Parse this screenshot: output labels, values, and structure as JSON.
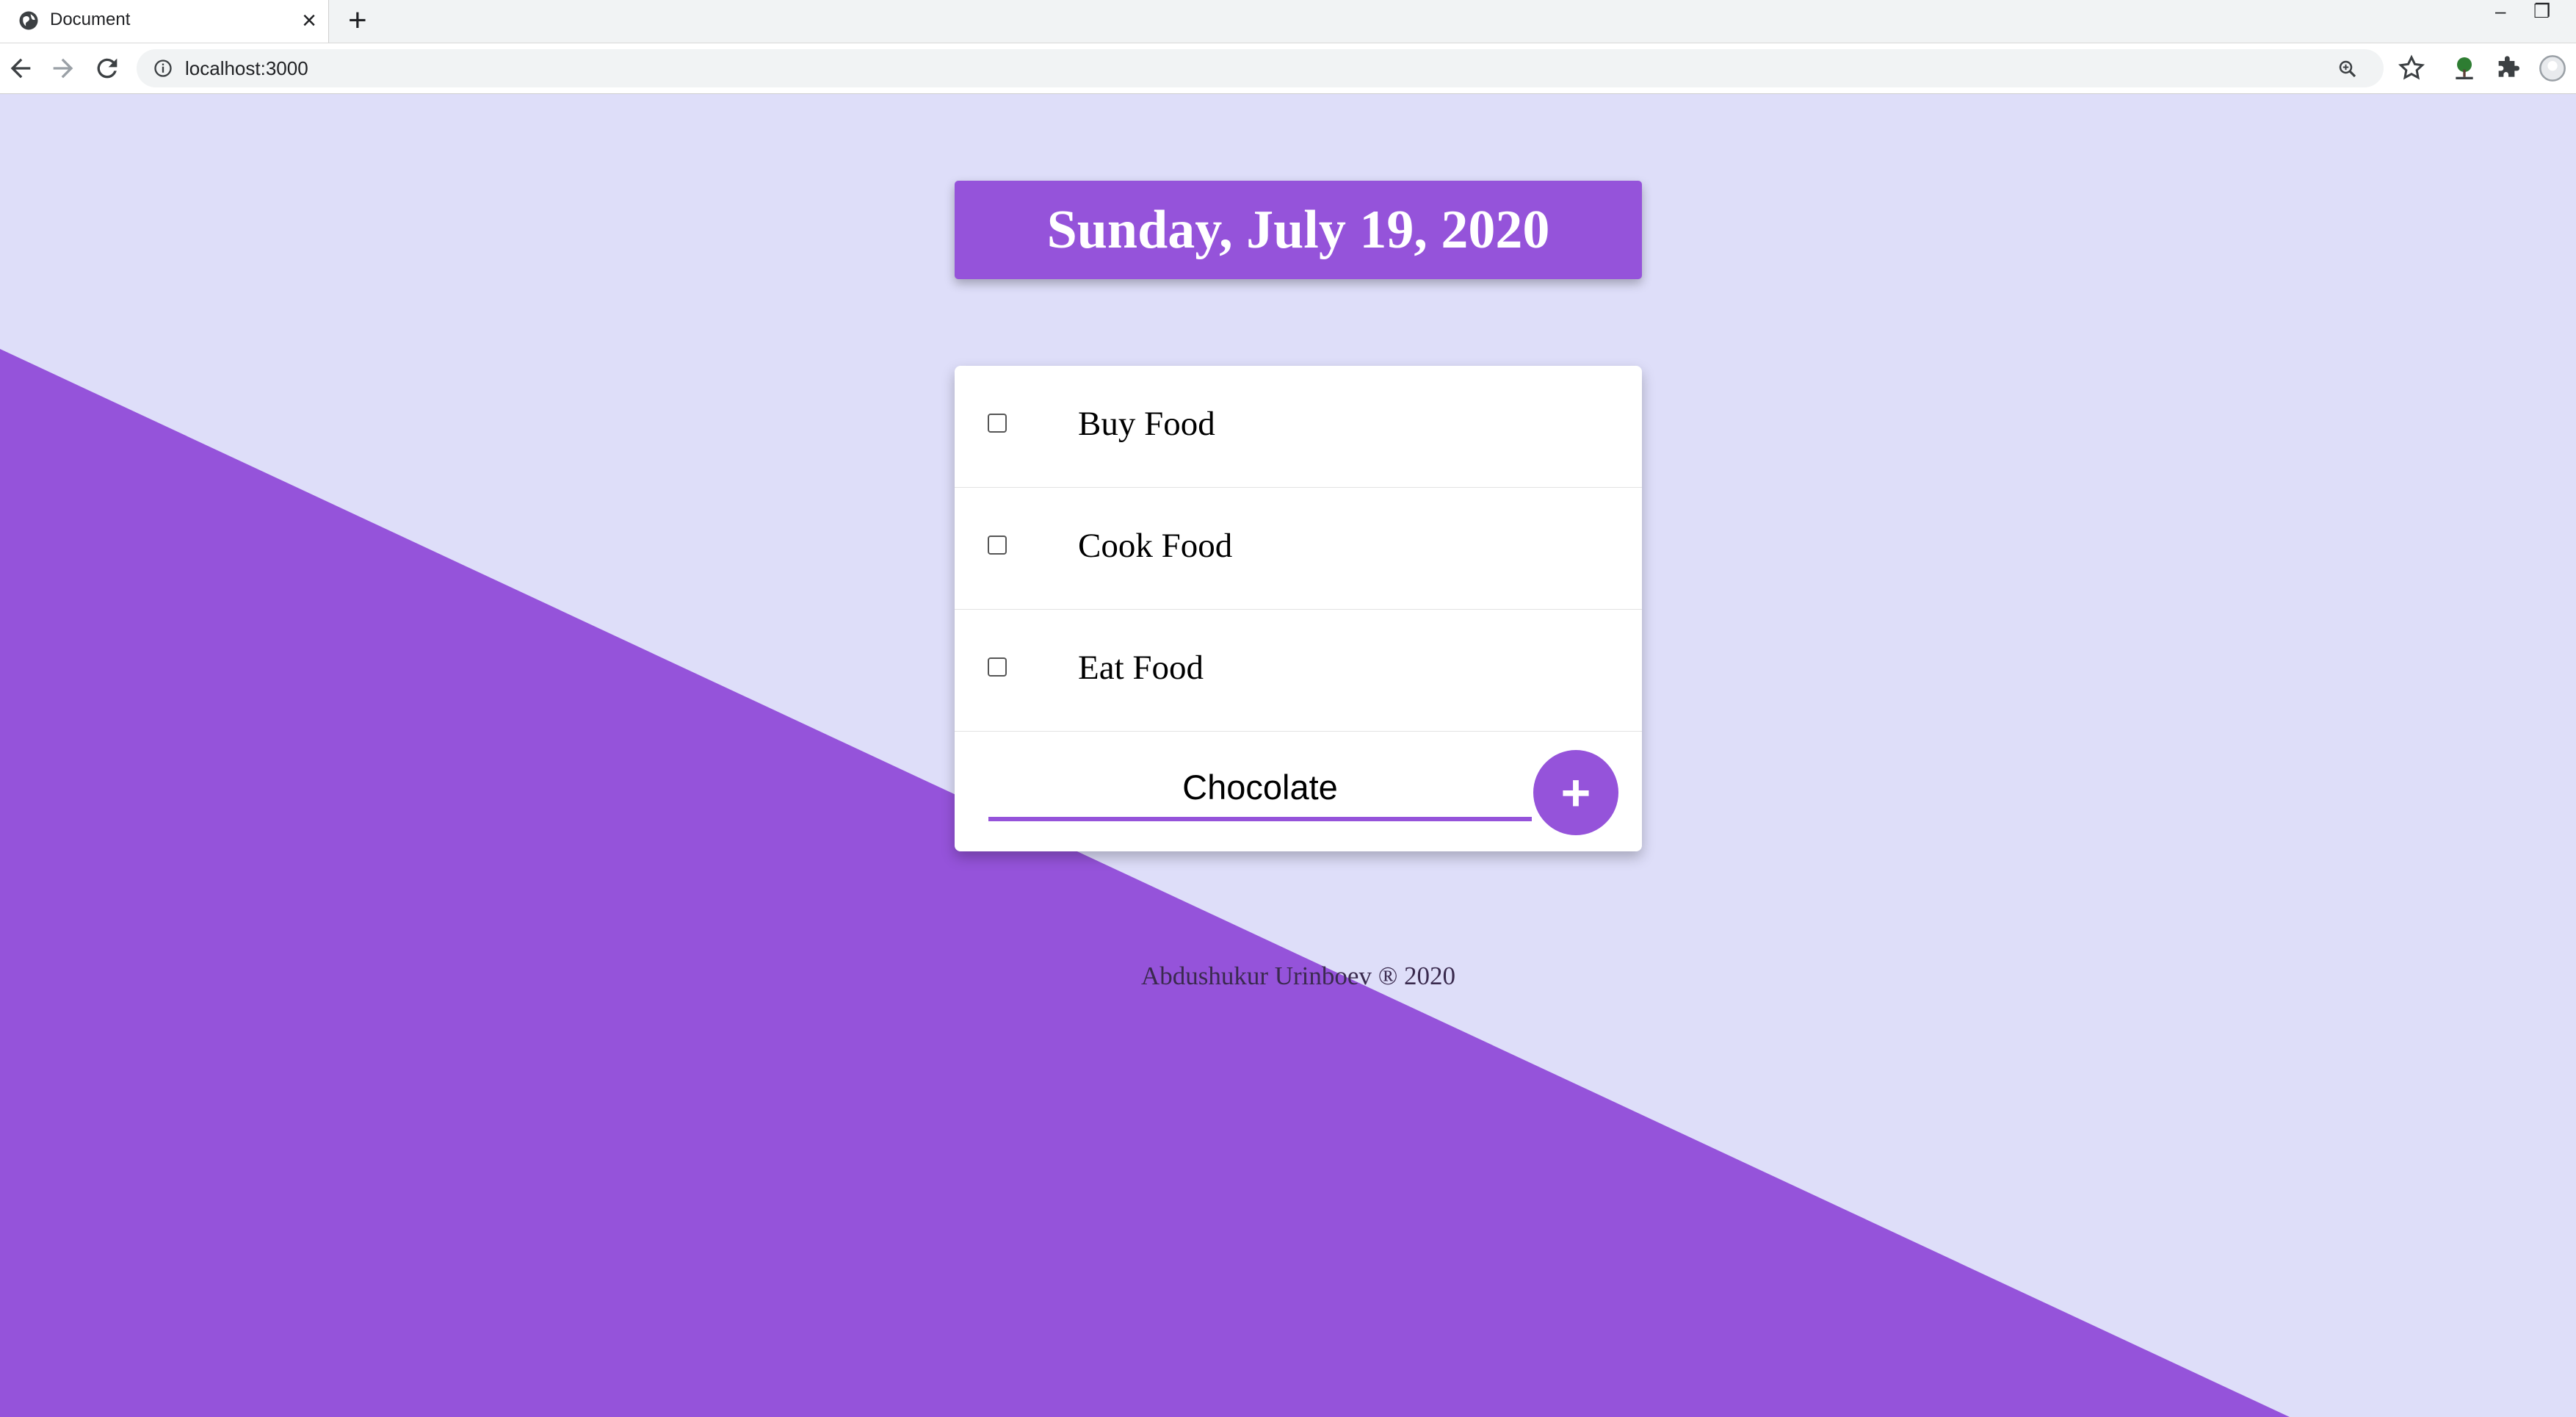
{
  "browser": {
    "tab_title": "Document",
    "tab_close": "×",
    "new_tab": "+",
    "url": "localhost:3000",
    "window_minimize": "–",
    "window_restore": "❐"
  },
  "page": {
    "date_heading": "Sunday, July 19, 2020",
    "items": [
      {
        "label": "Buy Food",
        "checked": false
      },
      {
        "label": "Cook Food",
        "checked": false
      },
      {
        "label": "Eat Food",
        "checked": false
      }
    ],
    "new_item": {
      "value": "Chocolate",
      "add_label": "+"
    },
    "footer": "Abdushukur Urinboev ® 2020"
  },
  "colors": {
    "accent": "#9553da",
    "background": "#dedef9",
    "card": "#ffffff"
  }
}
